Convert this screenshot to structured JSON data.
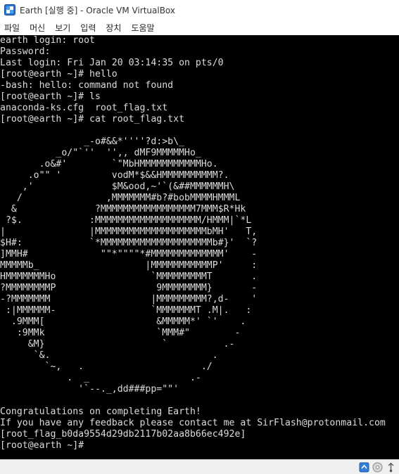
{
  "window": {
    "title": "Earth [실행 중] - Oracle VM VirtualBox",
    "app_icon": "virtualbox-icon"
  },
  "menubar": {
    "items": [
      "파일",
      "머신",
      "보기",
      "입력",
      "장치",
      "도움말"
    ]
  },
  "console": {
    "lines": [
      "earth login: root",
      "Password:",
      "Last login: Fri Jan 20 03:14:35 on pts/0",
      "[root@earth ~]# hello",
      "-bash: hello: command not found",
      "[root@earth ~]# ls",
      "anaconda-ks.cfg  root_flag.txt",
      "[root@earth ~]# cat root_flag.txt",
      "",
      "               _-o#&&*''''?d:>b\\_",
      "          _o/\"`''  '',, dMF9MMMMMHo_",
      "       .o&#'        `\"MbHMMMMMMMMMMMHo.",
      "     .o\"\" '         vodM*$&&HMMMMMMMMMM?.",
      "    ,'              $M&ood,~'`(&##MMMMMMH\\",
      "   /               ,MMMMMMM#b?#bobMMMMHMMML",
      "  &              ?MMMMMMMMMMMMMMMMM7MMM$R*Hk",
      " ?$.            :MMMMMMMMMMMMMMMMMMM/HMMM|`*L",
      "|               |MMMMMMMMMMMMMMMMMMMMbMH'   T,",
      "$H#:            `*MMMMMMMMMMMMMMMMMMMMb#}'  `?",
      "]MMH#             \"\"*\"\"\"\"*#MMMMMMMMMMMMM'    -",
      "MMMMMb_                   |MMMMMMMMMMMP'     :",
      "HMMMMMMMHo                 `MMMMMMMMMT       .",
      "?MMMMMMMMP                  9MMMMMMMM}       -",
      "-?MMMMMMM                  |MMMMMMMMM?,d-    '",
      " :|MMMMMM-                 `MMMMMMMT .M|.   :",
      "  .9MMM[                    &MMMMM*' `'    .",
      "   :9MMk                    `MMM#\"        -",
      "     &M}                     `          .-",
      "      `&.                             .",
      "        `~,   .                     ./",
      "            .  _                  .-",
      "              '`--._,dd###pp=\"\"'",
      "",
      "Congratulations on completing Earth!",
      "If you have any feedback please contact me at SirFlash@protonmail.com",
      "[root_flag_b0da9554d29db2117b02aa8b66ec492e]",
      "[root@earth ~]#"
    ]
  },
  "statusbar": {
    "icons": [
      "network-icon",
      "optical-drive-icon",
      "usb-icon"
    ]
  },
  "colors": {
    "console_bg": "#000000",
    "console_fg": "#dcdcdc",
    "titlebar_bg": "#ffffff",
    "statusbar_bg": "#f0f0f0"
  }
}
